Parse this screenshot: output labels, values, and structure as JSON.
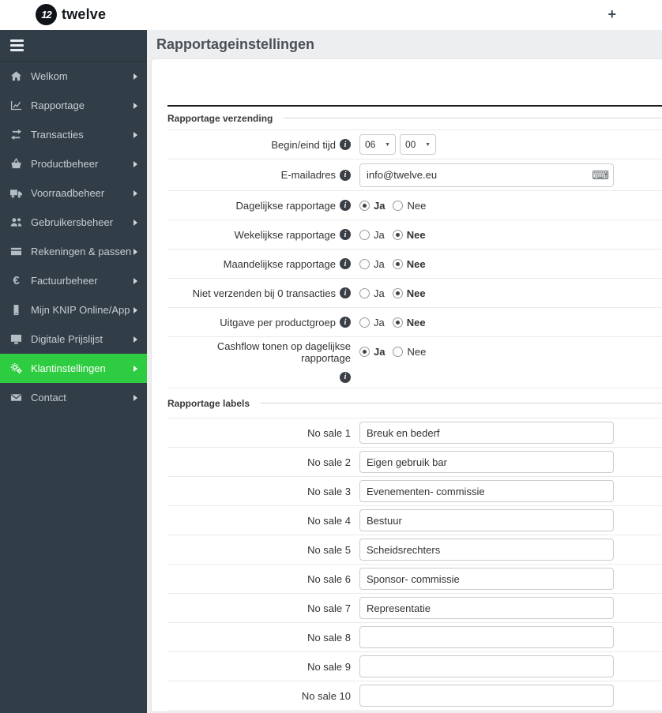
{
  "topbar": {
    "logo_badge": "12",
    "logo_text": "twelve",
    "plus": "+"
  },
  "sidebar": {
    "items": [
      {
        "label": "Welkom"
      },
      {
        "label": "Rapportage"
      },
      {
        "label": "Transacties"
      },
      {
        "label": "Productbeheer"
      },
      {
        "label": "Voorraadbeheer"
      },
      {
        "label": "Gebruikersbeheer"
      },
      {
        "label": "Rekeningen & passen"
      },
      {
        "label": "Factuurbeheer",
        "glyph": "€"
      },
      {
        "label": "Mijn KNIP Online/App"
      },
      {
        "label": "Digitale Prijslijst"
      },
      {
        "label": "Klantinstellingen",
        "active": true
      },
      {
        "label": "Contact"
      }
    ]
  },
  "page": {
    "title": "Rapportageinstellingen"
  },
  "icons": {
    "info": "i",
    "keyboard": "⌨",
    "select_caret": "▼"
  },
  "colors": {
    "accent_green": "#2ecc40",
    "sidebar_bg": "#313e47"
  },
  "verzending": {
    "legend": "Rapportage verzending",
    "time_row": {
      "label": "Begin/eind tijd",
      "hour": "06",
      "minute": "00"
    },
    "email_row": {
      "label": "E-mailadres",
      "value": "info@twelve.eu"
    },
    "radio_options": {
      "yes": "Ja",
      "no": "Nee"
    },
    "radio_rows": [
      {
        "label": "Dagelijkse rapportage",
        "selected": "Ja"
      },
      {
        "label": "Wekelijkse rapportage",
        "selected": "Nee"
      },
      {
        "label": "Maandelijkse rapportage",
        "selected": "Nee"
      },
      {
        "label": "Niet verzenden bij 0 transacties",
        "selected": "Nee"
      },
      {
        "label": "Uitgave per productgroep",
        "selected": "Nee"
      },
      {
        "label": "Cashflow tonen op dagelijkse rapportage",
        "selected": "Ja"
      }
    ]
  },
  "labels_section": {
    "legend": "Rapportage labels",
    "rows": [
      {
        "label": "No sale 1",
        "value": "Breuk en bederf"
      },
      {
        "label": "No sale 2",
        "value": "Eigen gebruik bar"
      },
      {
        "label": "No sale 3",
        "value": "Evenementen- commissie"
      },
      {
        "label": "No sale 4",
        "value": "Bestuur"
      },
      {
        "label": "No sale 5",
        "value": "Scheidsrechters"
      },
      {
        "label": "No sale 6",
        "value": "Sponsor- commissie"
      },
      {
        "label": "No sale 7",
        "value": "Representatie"
      },
      {
        "label": "No sale 8",
        "value": ""
      },
      {
        "label": "No sale 9",
        "value": ""
      },
      {
        "label": "No sale 10",
        "value": ""
      }
    ]
  }
}
